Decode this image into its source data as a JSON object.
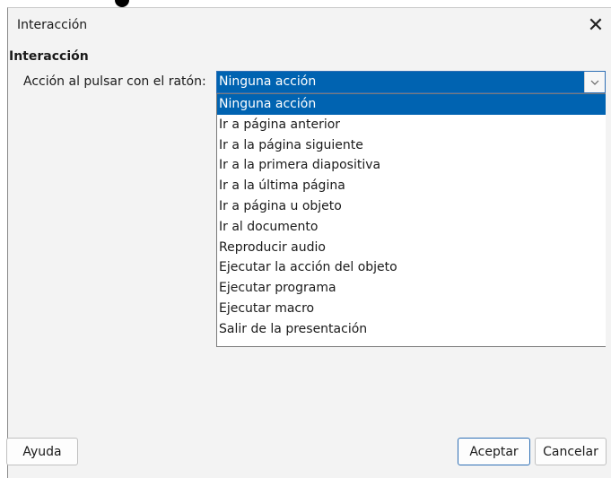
{
  "dialog": {
    "title": "Interacción",
    "close_glyph": "✕"
  },
  "section": {
    "heading": "Interacción",
    "field_label": "Acción al pulsar con el ratón:"
  },
  "combo": {
    "selected": "Ninguna acción",
    "arrow_icon": "chevron-down-icon"
  },
  "dropdown": {
    "options": [
      "Ninguna acción",
      "Ir a página anterior",
      "Ir a la página siguiente",
      "Ir a la primera diapositiva",
      "Ir a la última página",
      "Ir a página u objeto",
      "Ir al documento",
      "Reproducir audio",
      "Ejecutar la acción del objeto",
      "Ejecutar programa",
      "Ejecutar macro",
      "Salir de la presentación"
    ]
  },
  "buttons": {
    "help": "Ayuda",
    "ok": "Aceptar",
    "cancel": "Cancelar"
  },
  "colors": {
    "selection": "#0063b1",
    "dialog_bg": "#f3f3f3"
  }
}
